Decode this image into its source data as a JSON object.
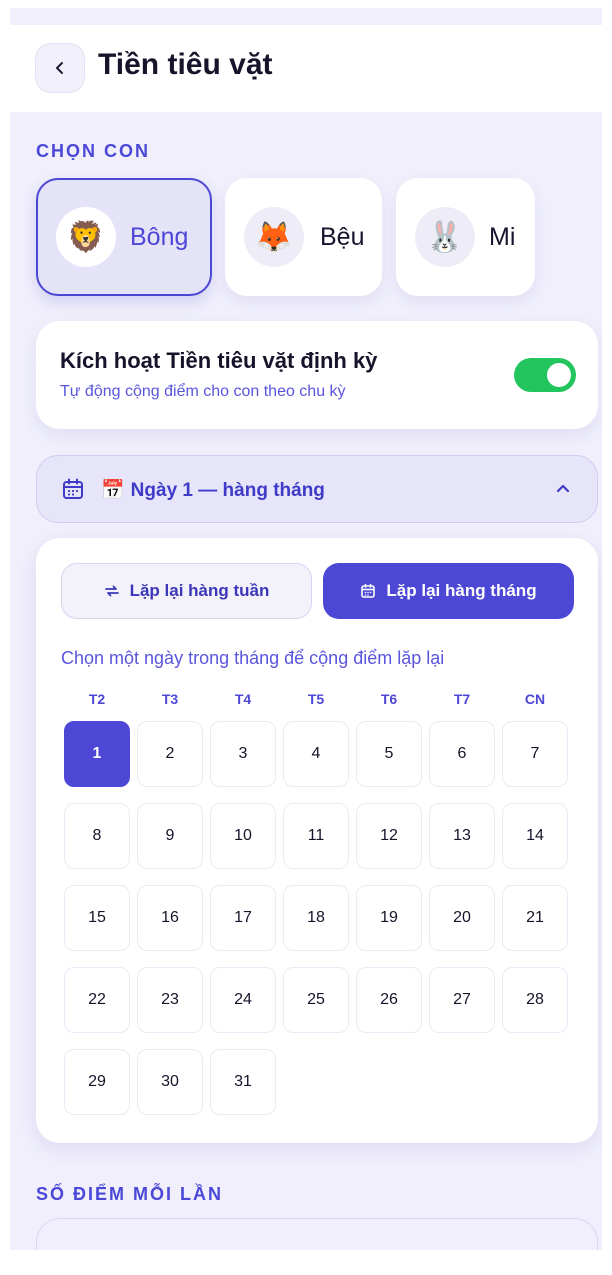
{
  "header": {
    "title": "Tiền tiêu vặt"
  },
  "children_section": {
    "label": "CHỌN CON",
    "children": [
      {
        "name": "Bông",
        "emoji": "🦁",
        "selected": true
      },
      {
        "name": "Bệu",
        "emoji": "🦊",
        "selected": false
      },
      {
        "name": "Mi",
        "emoji": "🐰",
        "selected": false
      }
    ]
  },
  "auto_allowance": {
    "title": "Kích hoạt Tiền tiêu vặt định kỳ",
    "subtitle": "Tự động cộng điểm cho con theo chu kỳ",
    "enabled": true
  },
  "schedule_dropdown": {
    "emoji": "📅",
    "label": "Ngày 1 — hàng tháng",
    "expanded": true
  },
  "repeat_options": {
    "weekly_label": "Lặp lại hàng tuần",
    "monthly_label": "Lặp lại hàng tháng",
    "selected": "monthly"
  },
  "calendar": {
    "hint": "Chọn một ngày trong tháng để cộng điểm lặp lại",
    "weekdays": [
      "T2",
      "T3",
      "T4",
      "T5",
      "T6",
      "T7",
      "CN"
    ],
    "days": [
      "1",
      "2",
      "3",
      "4",
      "5",
      "6",
      "7",
      "8",
      "9",
      "10",
      "11",
      "12",
      "13",
      "14",
      "15",
      "16",
      "17",
      "18",
      "19",
      "20",
      "21",
      "22",
      "23",
      "24",
      "25",
      "26",
      "27",
      "28",
      "29",
      "30",
      "31"
    ],
    "selected_day": "1"
  },
  "points_section": {
    "label": "SỐ ĐIỂM MỖI LẦN"
  },
  "colors": {
    "accent": "#4d47d6",
    "toggle_on": "#22c55e",
    "background": "#f0effb"
  },
  "icons": {
    "back": "chevron-left-icon",
    "calendar": "calendar-icon",
    "collapse": "chevron-up-icon",
    "repeat": "repeat-icon"
  }
}
